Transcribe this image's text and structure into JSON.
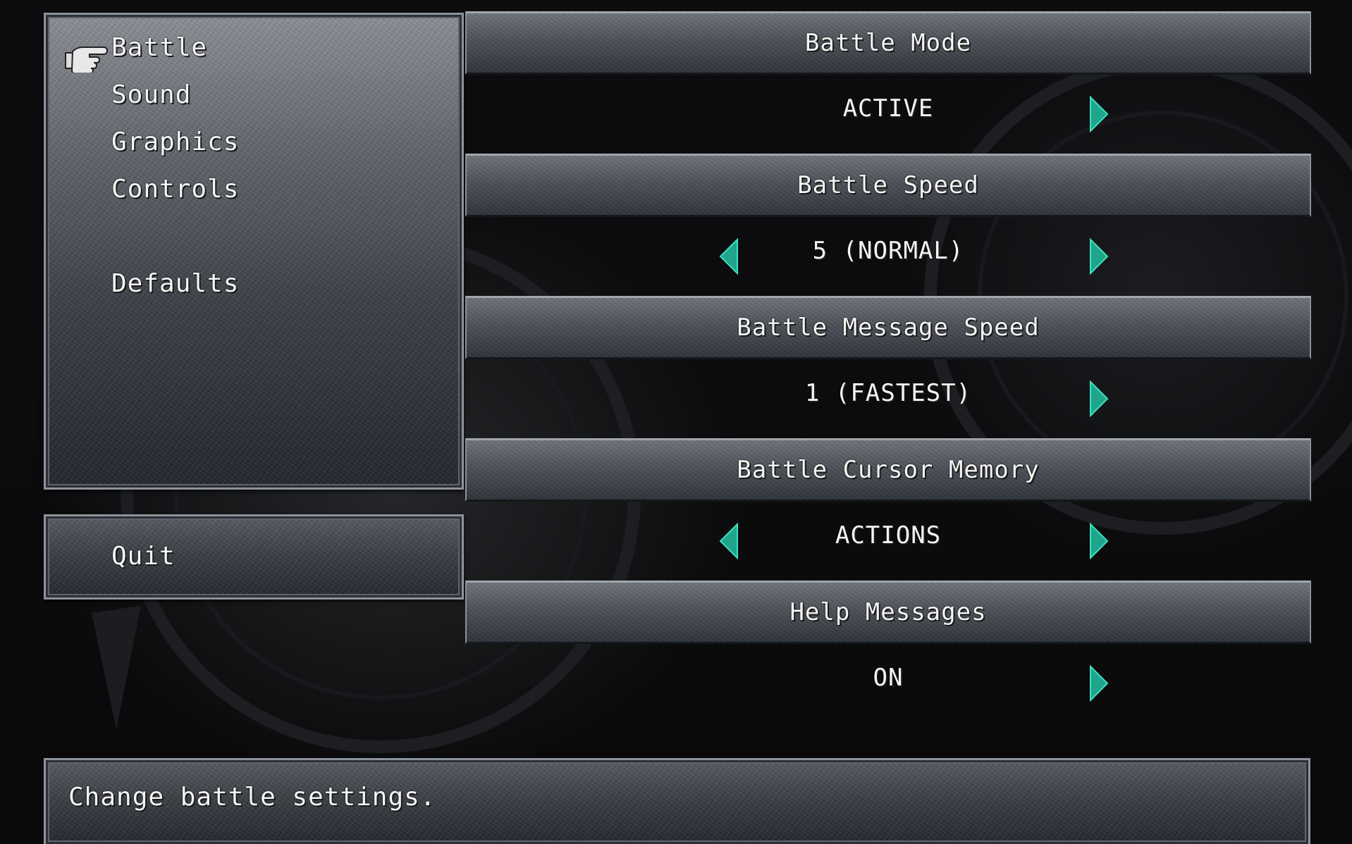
{
  "menu": {
    "items": [
      {
        "label": "Battle",
        "selected": true
      },
      {
        "label": "Sound",
        "selected": false
      },
      {
        "label": "Graphics",
        "selected": false
      },
      {
        "label": "Controls",
        "selected": false
      },
      {
        "label": "Defaults",
        "selected": false
      }
    ],
    "quit_label": "Quit",
    "cursor_icon": "pointing-hand-icon"
  },
  "settings": [
    {
      "title": "Battle Mode",
      "value": "ACTIVE",
      "left_arrow": false,
      "right_arrow": true
    },
    {
      "title": "Battle Speed",
      "value": "5 (NORMAL)",
      "left_arrow": true,
      "right_arrow": true
    },
    {
      "title": "Battle Message Speed",
      "value": "1 (FASTEST)",
      "left_arrow": false,
      "right_arrow": true
    },
    {
      "title": "Battle Cursor Memory",
      "value": "ACTIONS",
      "left_arrow": true,
      "right_arrow": true
    },
    {
      "title": "Help Messages",
      "value": "ON",
      "left_arrow": false,
      "right_arrow": true
    }
  ],
  "help": {
    "text": "Change battle settings."
  },
  "colors": {
    "arrow": "#1fa58c",
    "arrow_highlight": "#3fe0c0",
    "text": "#f4f4f4",
    "background": "#070708"
  }
}
